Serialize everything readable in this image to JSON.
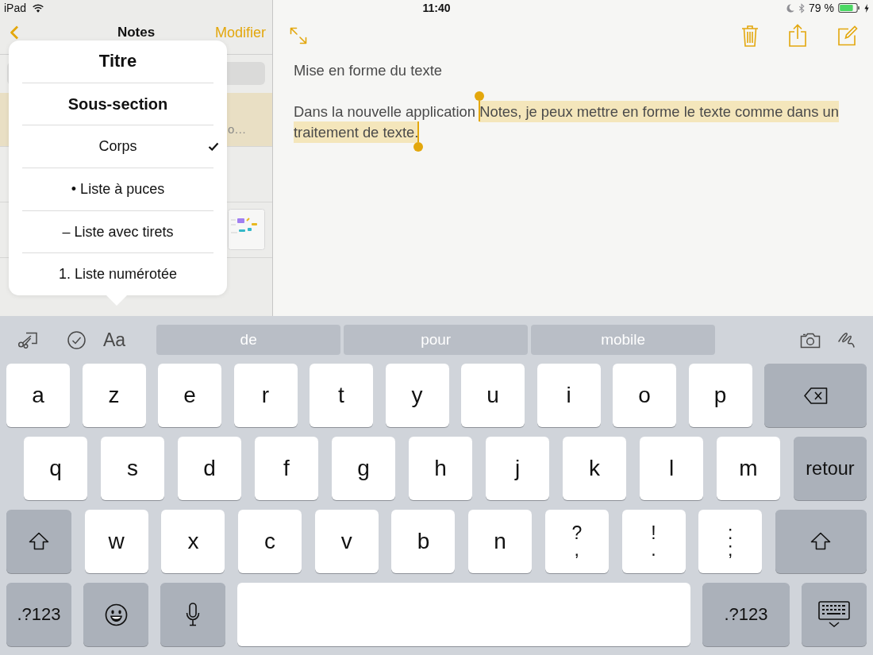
{
  "status_bar": {
    "device": "iPad",
    "time": "11:40",
    "battery": "79 %"
  },
  "sidebar": {
    "title": "Notes",
    "edit_button": "Modifier",
    "notes": [
      {
        "preview": "o…",
        "selected": true,
        "thumbnail": false
      },
      {
        "selected": false,
        "thumbnail": false
      },
      {
        "selected": false,
        "thumbnail": true
      }
    ]
  },
  "format_menu": {
    "items": [
      {
        "label": "Titre",
        "kind": "title",
        "selected": false
      },
      {
        "label": "Sous-section",
        "kind": "heading",
        "selected": false
      },
      {
        "label": "Corps",
        "kind": "body",
        "selected": true
      },
      {
        "label": "• Liste à puces",
        "kind": "body",
        "selected": false
      },
      {
        "label": "– Liste avec tirets",
        "kind": "body",
        "selected": false
      },
      {
        "label": "1. Liste numérotée",
        "kind": "body",
        "selected": false
      }
    ]
  },
  "note": {
    "title": "Mise en forme du texte",
    "body": [
      {
        "text": "Dans la nouvelle application ",
        "selected": false
      },
      {
        "text": "Notes, je peux mettre en forme le texte comme dans un traitement de texte.",
        "selected": true
      }
    ]
  },
  "keyboard": {
    "format_button": "Aa",
    "suggestions": [
      "de",
      "pour",
      "mobile"
    ],
    "key_rows": [
      {
        "keys": [
          {
            "kind": "letter",
            "label": "a"
          },
          {
            "kind": "letter",
            "label": "z"
          },
          {
            "kind": "letter",
            "label": "e"
          },
          {
            "kind": "letter",
            "label": "r"
          },
          {
            "kind": "letter",
            "label": "t"
          },
          {
            "kind": "letter",
            "label": "y"
          },
          {
            "kind": "letter",
            "label": "u"
          },
          {
            "kind": "letter",
            "label": "i"
          },
          {
            "kind": "letter",
            "label": "o"
          },
          {
            "kind": "letter",
            "label": "p"
          },
          {
            "kind": "delete"
          }
        ]
      },
      {
        "keys": [
          {
            "kind": "letter",
            "label": "q"
          },
          {
            "kind": "letter",
            "label": "s"
          },
          {
            "kind": "letter",
            "label": "d"
          },
          {
            "kind": "letter",
            "label": "f"
          },
          {
            "kind": "letter",
            "label": "g"
          },
          {
            "kind": "letter",
            "label": "h"
          },
          {
            "kind": "letter",
            "label": "j"
          },
          {
            "kind": "letter",
            "label": "k"
          },
          {
            "kind": "letter",
            "label": "l"
          },
          {
            "kind": "letter",
            "label": "m"
          },
          {
            "kind": "return",
            "label": "retour"
          }
        ]
      },
      {
        "keys": [
          {
            "kind": "shift",
            "on": false
          },
          {
            "kind": "letter",
            "label": "w"
          },
          {
            "kind": "letter",
            "label": "x"
          },
          {
            "kind": "letter",
            "label": "c"
          },
          {
            "kind": "letter",
            "label": "v"
          },
          {
            "kind": "letter",
            "label": "b"
          },
          {
            "kind": "letter",
            "label": "n"
          },
          {
            "kind": "punct",
            "label": "?",
            "label_2": ","
          },
          {
            "kind": "punct",
            "label": "!",
            "label_2": "."
          },
          {
            "kind": "punct",
            "label": ":",
            "label_2": ";"
          },
          {
            "kind": "shift",
            "on": false
          }
        ]
      },
      {
        "keys": [
          {
            "kind": "numbers",
            "label": ".?123"
          },
          {
            "kind": "emoji"
          },
          {
            "kind": "dictation"
          },
          {
            "kind": "space"
          },
          {
            "kind": "numbers",
            "label": ".?123"
          },
          {
            "kind": "hide"
          }
        ]
      }
    ]
  }
}
